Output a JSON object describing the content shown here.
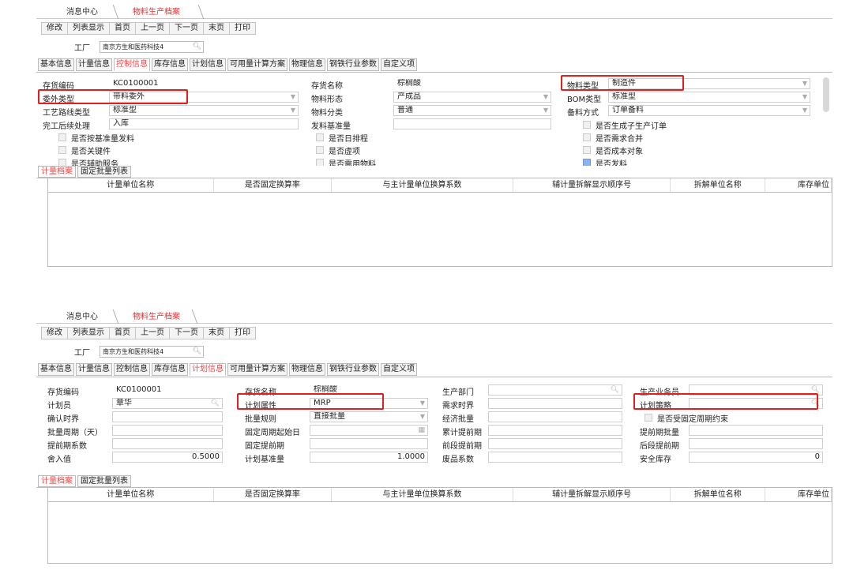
{
  "tabs": {
    "home": "消息中心",
    "current": "物料生产档案"
  },
  "toolbar": [
    "修改",
    "列表显示",
    "首页",
    "上一页",
    "下一页",
    "末页",
    "打印"
  ],
  "factory": {
    "label": "工厂",
    "value": "南京方生和医药科技4"
  },
  "sub_tabs": [
    "基本信息",
    "计量信息",
    "控制信息",
    "库存信息",
    "计划信息",
    "可用量计算方案",
    "物理信息",
    "钢铁行业参数",
    "自定义项"
  ],
  "colors": {
    "active_tab": "#e44444",
    "highlight_box": "#e02020"
  },
  "shot1": {
    "active_sub_tab": "控制信息",
    "fields": {
      "inv_code_label": "存货编码",
      "inv_code": "KC0100001",
      "inv_name_label": "存货名称",
      "inv_name": "棕榈酸",
      "mat_type_label": "物料类型",
      "mat_type": "制造件",
      "outsource_label": "委外类型",
      "outsource": "带料委外",
      "form_label": "物料形态",
      "form": "产成品",
      "bom_label": "BOM类型",
      "bom": "标准型",
      "route_label": "工艺路线类型",
      "route": "标准型",
      "class_label": "物料分类",
      "class": "普通",
      "stock_label": "备料方式",
      "stock": "订单备料",
      "after_label": "完工后续处理",
      "after": "入库",
      "issue_label": "发料基准量",
      "cb_sub_order": "是否生成子生产订单",
      "cb_base_issue": "是否按基准量发料",
      "cb_daily": "是否日排程",
      "cb_merge": "是否需求合并",
      "cb_key": "是否关键件",
      "cb_virtual": "是否虚项",
      "cb_cost": "是否成本对象",
      "cb_cut1": "是否辅助服务",
      "cb_cut2": "是否需用物料",
      "cb_cut3": "是否发料"
    }
  },
  "shot2": {
    "active_sub_tab": "计划信息",
    "fields": {
      "inv_code_label": "存货编码",
      "inv_code": "KC0100001",
      "inv_name_label": "存货名称",
      "inv_name": "棕榈酸",
      "dept_label": "生产部门",
      "dept": "",
      "staff_label": "生产业务员",
      "staff": "",
      "planner_label": "计划员",
      "planner": "章华",
      "attr_label": "计划属性",
      "attr": "MRP",
      "fence_label": "需求时界",
      "fence": "",
      "strategy_label": "计划策略",
      "strategy": "",
      "confirm_label": "确认时界",
      "confirm": "",
      "rule_label": "批量规则",
      "rule": "直接批量",
      "eco_label": "经济批量",
      "eco": "",
      "fixed_cycle": "是否受固定周期约束",
      "cycle_label": "批量周期（天）",
      "cycle": "",
      "start_label": "固定周期起始日",
      "start": "",
      "cum_label": "累计提前期",
      "cum": "",
      "pre_batch_label": "提前期批量",
      "pre_batch": "",
      "coef_label": "提前期系数",
      "coef": "",
      "fixed_lead_label": "固定提前期",
      "fixed_lead": "",
      "front_label": "前段提前期",
      "front": "",
      "back_label": "后段提前期",
      "back": "",
      "round_label": "舍入值",
      "round": "0.5000",
      "base_label": "计划基准量",
      "base": "1.0000",
      "scrap_label": "废品系数",
      "scrap": "",
      "safety_label": "安全库存",
      "safety": "0"
    }
  },
  "grid": {
    "tabs": [
      "计量档案",
      "固定批量列表"
    ],
    "columns": [
      "计量单位名称",
      "是否固定换算率",
      "与主计量单位换算系数",
      "辅计量拆解显示顺序号",
      "拆解单位名称",
      "库存单位"
    ]
  }
}
